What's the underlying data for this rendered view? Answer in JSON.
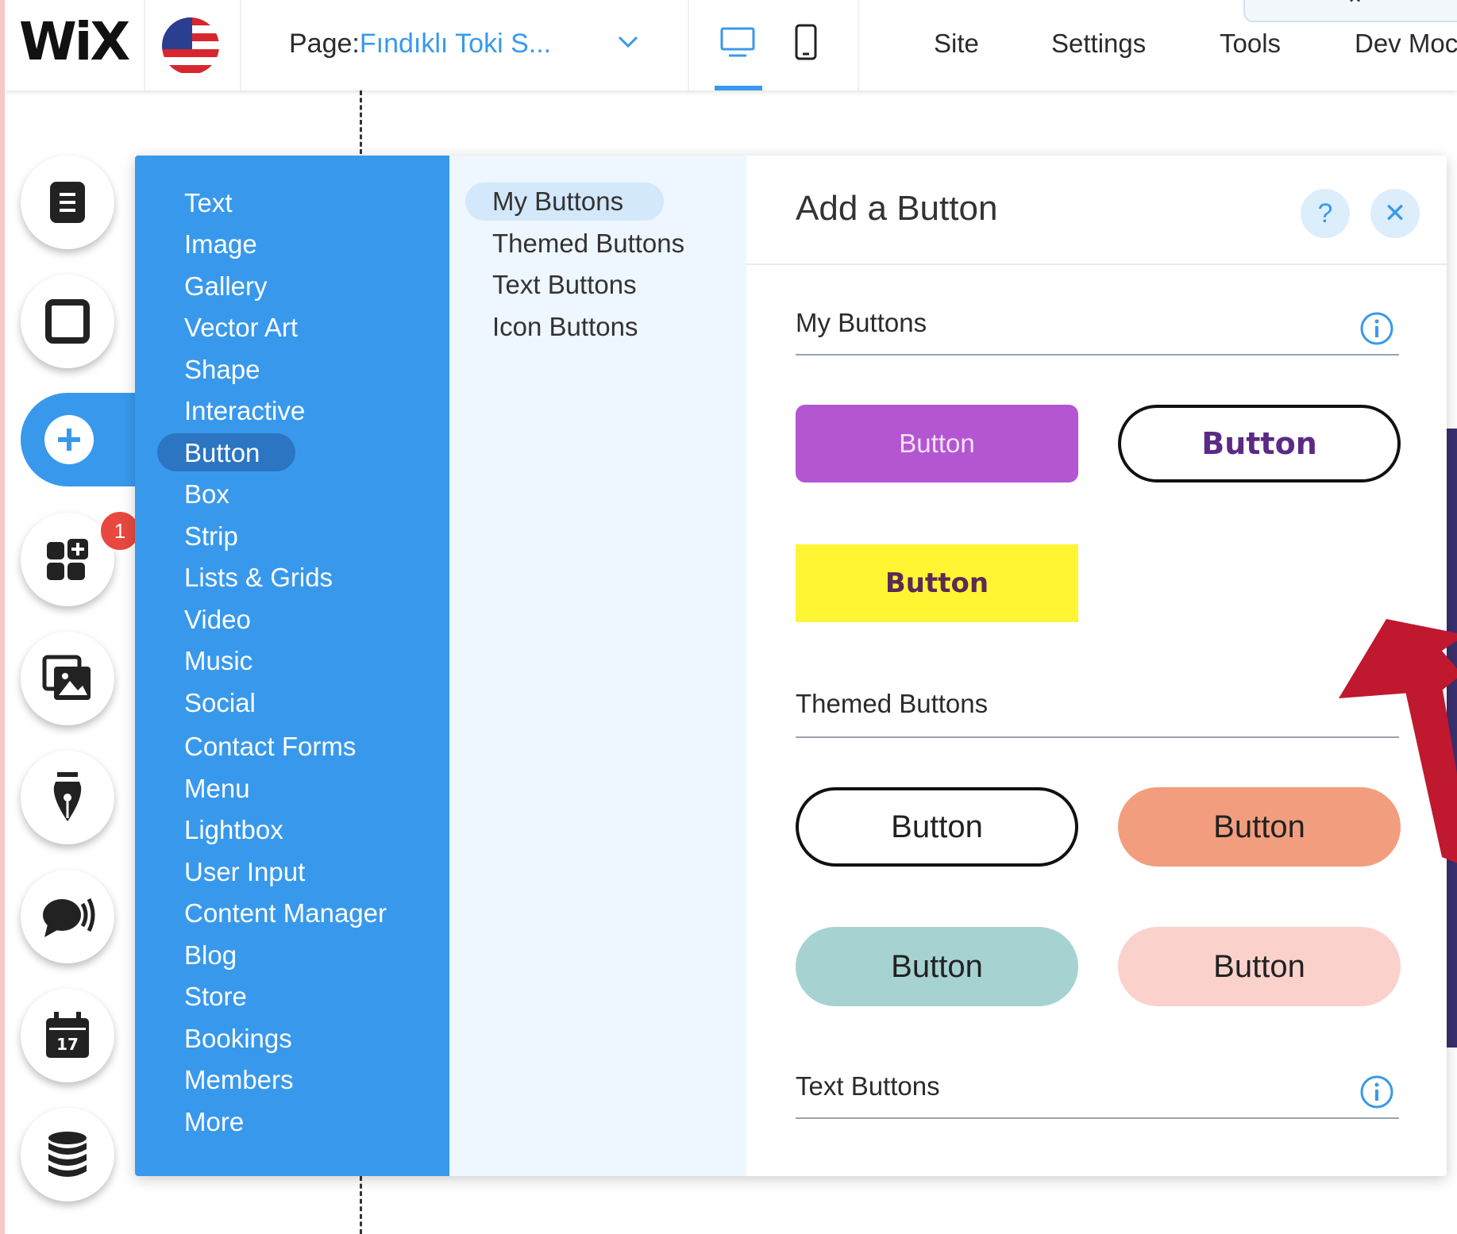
{
  "topbar": {
    "logo": "WiX",
    "page_label": "Page:",
    "page_value": "Fındıklı Toki S...",
    "menu": [
      "Site",
      "Settings",
      "Tools",
      "Dev Moc"
    ],
    "collapse_glyph": "⌃"
  },
  "rail": {
    "badge_count": "1",
    "icons": [
      "pages-icon",
      "section-icon",
      "add-icon",
      "app-market-icon",
      "media-icon",
      "pen-icon",
      "chat-icon",
      "calendar-icon",
      "database-icon"
    ]
  },
  "panel": {
    "categories": [
      "Text",
      "Image",
      "Gallery",
      "Vector Art",
      "Shape",
      "Interactive",
      "Button",
      "Box",
      "Strip",
      "Lists & Grids",
      "Video",
      "Music",
      "Social",
      "Contact Forms",
      "Menu",
      "Lightbox",
      "User Input",
      "Content Manager",
      "Blog",
      "Store",
      "Bookings",
      "Members",
      "More"
    ],
    "selected_category": "Button",
    "subcategories": [
      "My Buttons",
      "Themed Buttons",
      "Text Buttons",
      "Icon Buttons"
    ],
    "selected_subcategory": "My Buttons",
    "title": "Add a Button",
    "help_glyph": "?",
    "close_glyph": "✕",
    "sections": {
      "my_buttons": "My Buttons",
      "themed_buttons": "Themed Buttons",
      "text_buttons": "Text Buttons"
    },
    "button_label": "Button"
  },
  "colors": {
    "accent": "#3899ec",
    "purple_button": "#b455d1",
    "yellow_button": "#fff533",
    "salmon_button": "#f29e7e",
    "teal_button": "#a6d2d2",
    "pink_button": "#fbd1cc",
    "arrow": "#c0182f"
  }
}
